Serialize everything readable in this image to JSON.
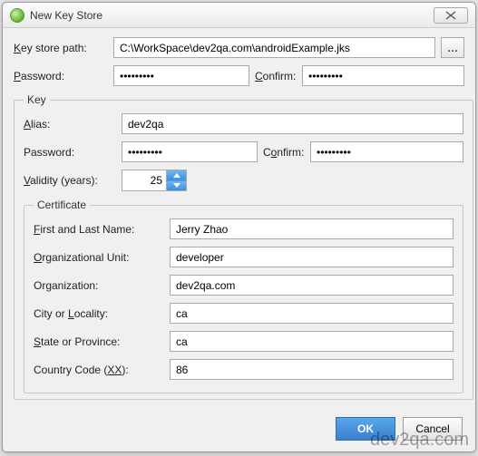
{
  "window": {
    "title": "New Key Store"
  },
  "form": {
    "path_label_pre": "Key store path:",
    "path_underline_char": "K",
    "path_value": "C:\\WorkSpace\\dev2qa.com\\androidExample.jks",
    "browse_label": "…",
    "pw_label": "Password:",
    "pw_underline_char": "P",
    "pw_value": "•••••••••",
    "confirm_label": "Confirm:",
    "confirm_underline_char": "C",
    "confirm_value": "•••••••••"
  },
  "key": {
    "legend": "Key",
    "alias_label": "Alias:",
    "alias_underline_char": "A",
    "alias_value": "dev2qa",
    "pw_label": "Password:",
    "pw_value": "•••••••••",
    "confirm_label": "Confirm:",
    "confirm_underline_char": "o",
    "confirm_value": "•••••••••",
    "validity_label": "Validity (years):",
    "validity_underline_char": "V",
    "validity_value": "25"
  },
  "cert": {
    "legend": "Certificate",
    "first_last_label": "First and Last Name:",
    "first_last_underline_char": "F",
    "first_last_value": "Jerry Zhao",
    "ou_label": "Organizational Unit:",
    "ou_underline_char": "O",
    "ou_value": "developer",
    "org_label": "Organization:",
    "org_value": "dev2qa.com",
    "city_label": "City or Locality:",
    "city_underline_char": "L",
    "city_value": "ca",
    "state_label": "State or Province:",
    "state_underline_char": "S",
    "state_value": "ca",
    "cc_label_pre": "Country Code (",
    "cc_label_post": "):",
    "cc_underline_chars": "XX",
    "cc_value": "86"
  },
  "footer": {
    "ok_label": "OK",
    "cancel_label": "Cancel"
  },
  "watermark": "dev2qa.com"
}
